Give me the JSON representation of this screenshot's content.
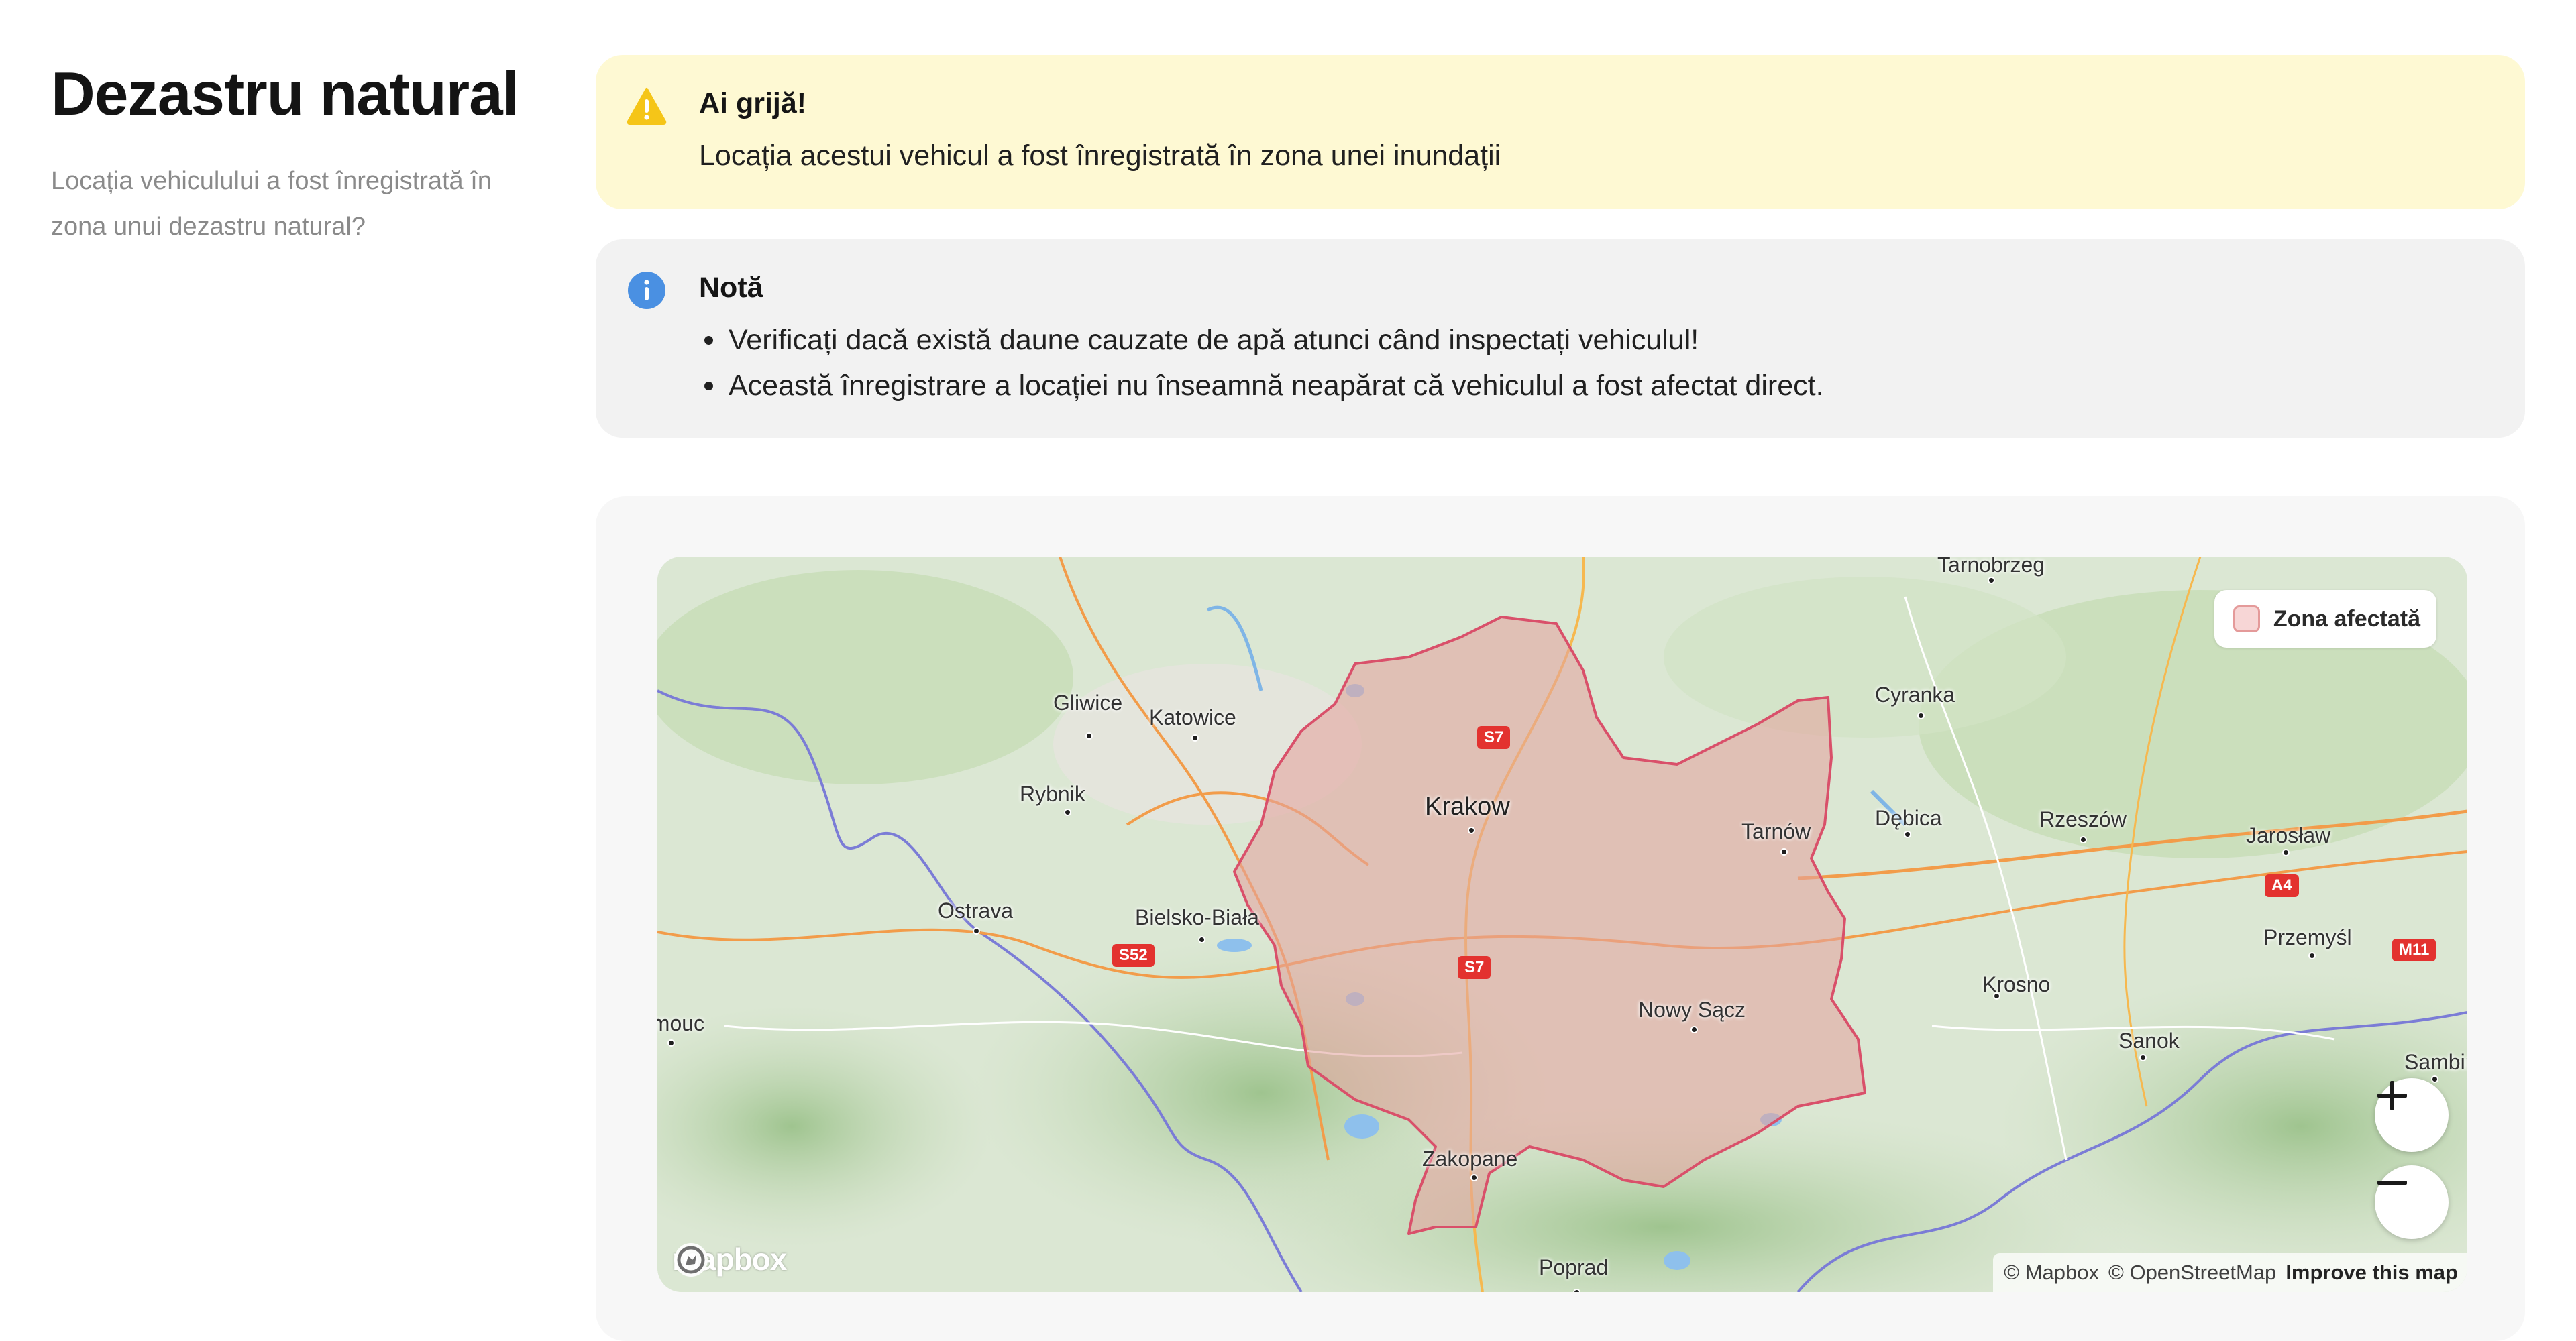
{
  "section": {
    "title": "Dezastru natural",
    "subtitle": "Locația vehiculului a fost înregistrată în zona unui dezastru natural?"
  },
  "warning": {
    "icon": "warning-triangle-icon",
    "title": "Ai grijă!",
    "text": "Locația acestui vehicul a fost înregistrată în zona unei inundații"
  },
  "note": {
    "icon": "info-circle-icon",
    "title": "Notă",
    "items": [
      "Verificați dacă există daune cauzate de apă atunci când inspectați vehiculul!",
      "Această înregistrare a locației nu înseamnă neapărat că vehiculul a fost afectat direct."
    ]
  },
  "map": {
    "legend_label": "Zona afectată",
    "zoom_in_icon": "plus-icon",
    "zoom_out_icon": "minus-icon",
    "logo_text": "mapbox",
    "attribution": {
      "mapbox": "© Mapbox",
      "osm": "© OpenStreetMap",
      "improve": "Improve this map"
    },
    "cities": [
      "Tarnobrzeg",
      "Gliwice",
      "Katowice",
      "Rybnik",
      "Krakow",
      "Cyranka",
      "Tarnów",
      "Dębica",
      "Rzeszów",
      "Jarosław",
      "Ostrava",
      "Bielsko-Biała",
      "Przemyśl",
      "Krosno",
      "Nowy Sącz",
      "Sanok",
      "Olomouc",
      "Sambir",
      "Zakopane",
      "Poprad"
    ],
    "road_shields": [
      "S7",
      "S7",
      "S52",
      "A4",
      "M11"
    ]
  },
  "colors": {
    "warning_bg": "#fef9d3",
    "warning_icon": "#f5c518",
    "note_bg": "#f2f2f2",
    "info_icon": "#4a90e2",
    "affected_fill": "#e6a5a0",
    "affected_stroke": "#d9506a"
  }
}
